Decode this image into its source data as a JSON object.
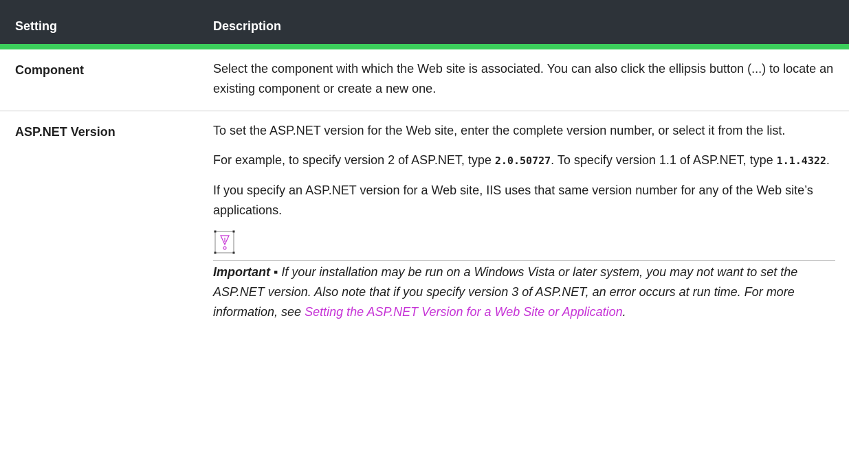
{
  "table": {
    "headers": [
      "Setting",
      "Description"
    ],
    "rows": [
      {
        "setting": "Component",
        "description": "Select the component with which the Web site is associated. You can also click the ellipsis button (...) to locate an existing component or create a new one."
      },
      {
        "setting": "ASP.NET Version",
        "p1": "To set the ASP.NET version for the Web site, enter the complete version number, or select it from the list.",
        "p2_before": "For example, to specify version 2 of ASP.NET, type ",
        "p2_code1": "2.0.50727",
        "p2_middle": ". To specify version 1.1 of ASP.NET, type ",
        "p2_code2": "1.1.4322",
        "p2_after": ".",
        "p3": "If you specify an ASP.NET version for a Web site, IIS uses that same version number for any of the Web site’s applications.",
        "note_label": "Important",
        "note_sep": " ▪ ",
        "note_text": "If your installation may be run on a Windows Vista or later system, you may not want to set the ASP.NET version. Also note that if you specify version 3 of ASP.NET, an error occurs at run time. For more information, see ",
        "note_link": "Setting the ASP.NET Version for a Web Site or Application",
        "note_end": "."
      }
    ]
  },
  "colors": {
    "header_bg": "#2d3339",
    "accent": "#3bce5b",
    "link": "#c633d6"
  },
  "icons": {
    "note": "important-icon"
  }
}
